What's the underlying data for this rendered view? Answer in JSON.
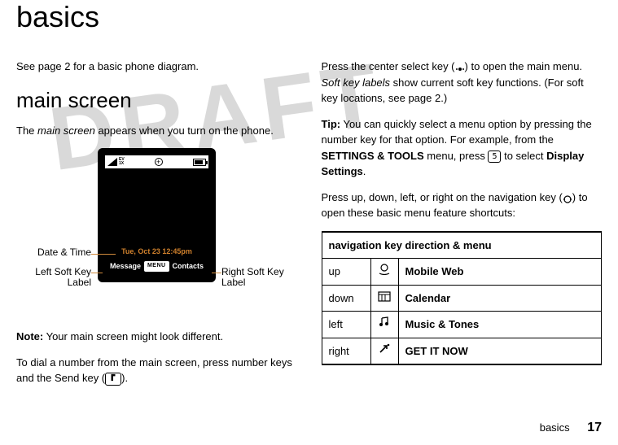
{
  "watermark": "DRAFT",
  "title": "basics",
  "left": {
    "intro": "See page 2 for a basic phone diagram.",
    "heading": "main screen",
    "desc_pre": "The ",
    "desc_em": "main screen",
    "desc_post": " appears when you turn on the phone.",
    "note_label": "Note:",
    "note_text": " Your main screen might look different.",
    "dial_pre": "To dial a number from the main screen, press number keys and the Send key (",
    "dial_post": ")."
  },
  "phone": {
    "ev": "EV",
    "onex": "1X",
    "datetime": "Tue, Oct 23 12:45pm",
    "left_sk": "Message",
    "menu": "MENU",
    "right_sk": "Contacts",
    "callout_datetime": "Date & Time",
    "callout_left1": "Left Soft Key",
    "callout_left2": "Label",
    "callout_right1": "Right Soft Key",
    "callout_right2": "Label"
  },
  "right": {
    "p1_pre": "Press the center select key (",
    "p1_mid": ") to open the main menu. ",
    "p1_em": "Soft key labels",
    "p1_post": " show current soft key functions. (For soft key locations, see page 2.)",
    "tip_label": "Tip:",
    "tip_a": " You can quickly select a menu option by pressing the number key for that option. For example, from the ",
    "tip_menu": "SETTINGS & TOOLS",
    "tip_b": " menu, press ",
    "tip_key": "5",
    "tip_c": " to select ",
    "tip_item": "Display Settings",
    "tip_d": ".",
    "p3_pre": "Press up, down, left, or right on the navigation key (",
    "p3_post": ") to open these basic menu feature shortcuts:"
  },
  "table": {
    "header": "navigation key direction & menu",
    "rows": [
      {
        "dir": "up",
        "label": "Mobile Web"
      },
      {
        "dir": "down",
        "label": "Calendar"
      },
      {
        "dir": "left",
        "label": "Music & Tones"
      },
      {
        "dir": "right",
        "label": "GET IT NOW"
      }
    ]
  },
  "footer": {
    "section": "basics",
    "page": "17"
  }
}
